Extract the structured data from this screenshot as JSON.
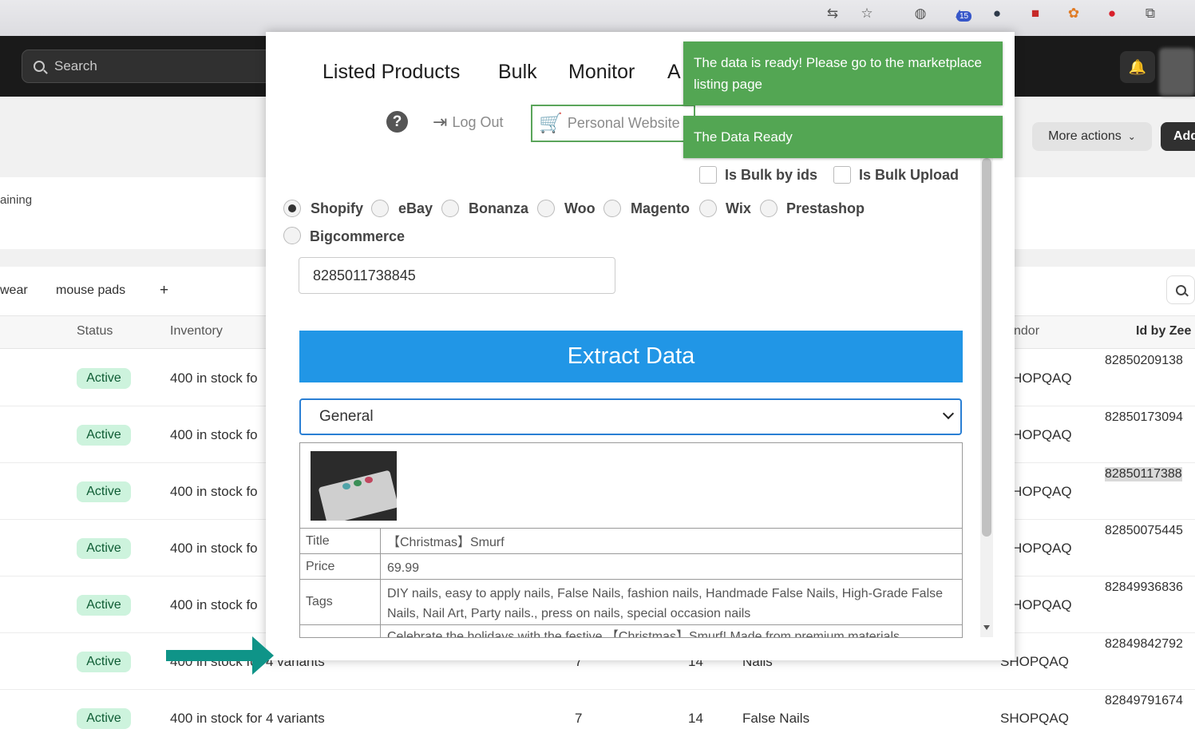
{
  "browser": {
    "badge_count": "15"
  },
  "admin": {
    "search_placeholder": "Search",
    "more_actions_label": "More actions",
    "add_label": "Add",
    "remaining_text": "aining",
    "tabs": [
      "wear",
      "mouse pads",
      "+"
    ],
    "columns": {
      "status": "Status",
      "inventory": "Inventory",
      "vendor": "ndor",
      "id": "Id by Zee"
    },
    "rows": [
      {
        "status": "Active",
        "inventory": "400 in stock fo",
        "vendor": "HOPQAQ",
        "id": "82850209138"
      },
      {
        "status": "Active",
        "inventory": "400 in stock fo",
        "vendor": "HOPQAQ",
        "id": "82850173094"
      },
      {
        "status": "Active",
        "inventory": "400 in stock fo",
        "vendor": "HOPQAQ",
        "id": "82850117388"
      },
      {
        "status": "Active",
        "inventory": "400 in stock fo",
        "vendor": "HOPQAQ",
        "id": "82850075445"
      },
      {
        "status": "Active",
        "inventory": "400 in stock fo",
        "vendor": "HOPQAQ",
        "id": "82849936836"
      },
      {
        "status": "Active",
        "inventory": "400 in stock for 4 variants",
        "col_a": "7",
        "col_b": "14",
        "type": "Nails",
        "vendor": "SHOPQAQ",
        "id": "82849842792"
      },
      {
        "status": "Active",
        "inventory": "400 in stock for 4 variants",
        "col_a": "7",
        "col_b": "14",
        "type": "False Nails",
        "vendor": "SHOPQAQ",
        "id": "82849791674"
      }
    ]
  },
  "popup": {
    "nav": [
      "Listed Products",
      "Bulk",
      "Monitor",
      "A"
    ],
    "logout_label": "Log Out",
    "personal_website_label": "Personal Website",
    "bulk_by_ids_label": "Is Bulk by ids",
    "bulk_upload_label": "Is Bulk Upload",
    "platforms": [
      "Shopify",
      "eBay",
      "Bonanza",
      "Woo",
      "Magento",
      "Wix",
      "Prestashop",
      "Bigcommerce"
    ],
    "selected_platform": "Shopify",
    "id_value": "8285011738845",
    "extract_label": "Extract Data",
    "view_select": "General",
    "product": {
      "title_label": "Title",
      "title": "【Christmas】Smurf",
      "price_label": "Price",
      "price": "69.99",
      "tags_label": "Tags",
      "tags": "DIY nails, easy to apply nails, False Nails, fashion nails, Handmade False Nails, High-Grade False Nails, Nail Art, Party nails., press on nails, special occasion nails",
      "description": "Celebrate the holidays with the festive 【Christmas】Smurf! Made from premium materials"
    }
  },
  "toasts": {
    "ready_message": "The data is ready! Please go to the marketplace listing page",
    "ready_short": "The Data Ready"
  },
  "colors": {
    "toast_green": "#53a653",
    "extract_blue": "#2196e6",
    "annotation_arrow": "#0f9488",
    "status_active_bg": "#cdf3dd"
  }
}
